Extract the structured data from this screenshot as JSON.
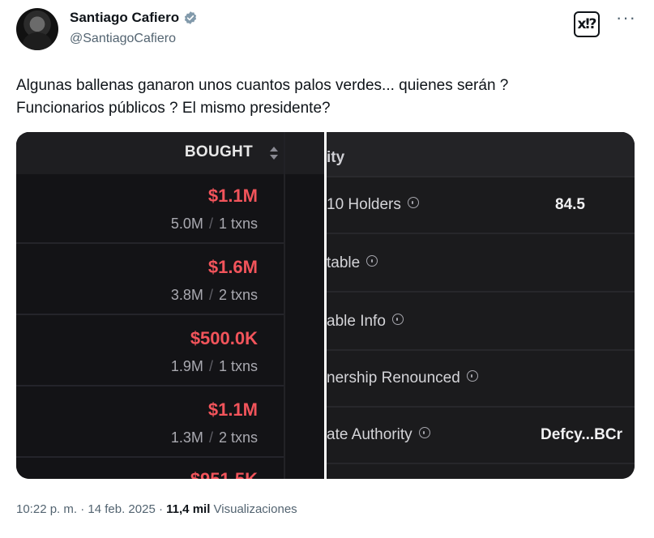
{
  "author": {
    "display_name": "Santiago Cafiero",
    "handle": "@SantiagoCafiero",
    "verified_color": "#829aab"
  },
  "actions": {
    "grok_label": "x⁉",
    "more_label": "···"
  },
  "tweet": {
    "line1": "Algunas ballenas ganaron unos cuantos palos verdes... quienes serán ?",
    "line2": "Funcionarios públicos ? El mismo presidente?"
  },
  "media": {
    "left": {
      "column_header": "BOUGHT",
      "rows": [
        {
          "amount": "$1.1M",
          "qty": "5.0M",
          "sep": "/",
          "txns": "1 txns"
        },
        {
          "amount": "$1.6M",
          "qty": "3.8M",
          "sep": "/",
          "txns": "2 txns"
        },
        {
          "amount": "$500.0K",
          "qty": "1.9M",
          "sep": "/",
          "txns": "1 txns"
        },
        {
          "amount": "$1.1M",
          "qty": "1.3M",
          "sep": "/",
          "txns": "2 txns"
        }
      ],
      "partial_amount": "$951.5K"
    },
    "right": {
      "header": "ity",
      "rows": [
        {
          "label": "10 Holders",
          "value": "84.5"
        },
        {
          "label": "table",
          "value": ""
        },
        {
          "label": "able Info",
          "value": ""
        },
        {
          "label": "nership Renounced",
          "value": ""
        },
        {
          "label": "ate Authority",
          "value": "Defcy...BCr"
        }
      ]
    },
    "colors": {
      "amount": "#f2545b",
      "panel_bg": "#131316"
    }
  },
  "footer": {
    "time": "10:22 p. m.",
    "dot1": "·",
    "date": "14 feb. 2025",
    "dot2": "·",
    "views_count": "11,4 mil",
    "views_label": "Visualizaciones"
  }
}
